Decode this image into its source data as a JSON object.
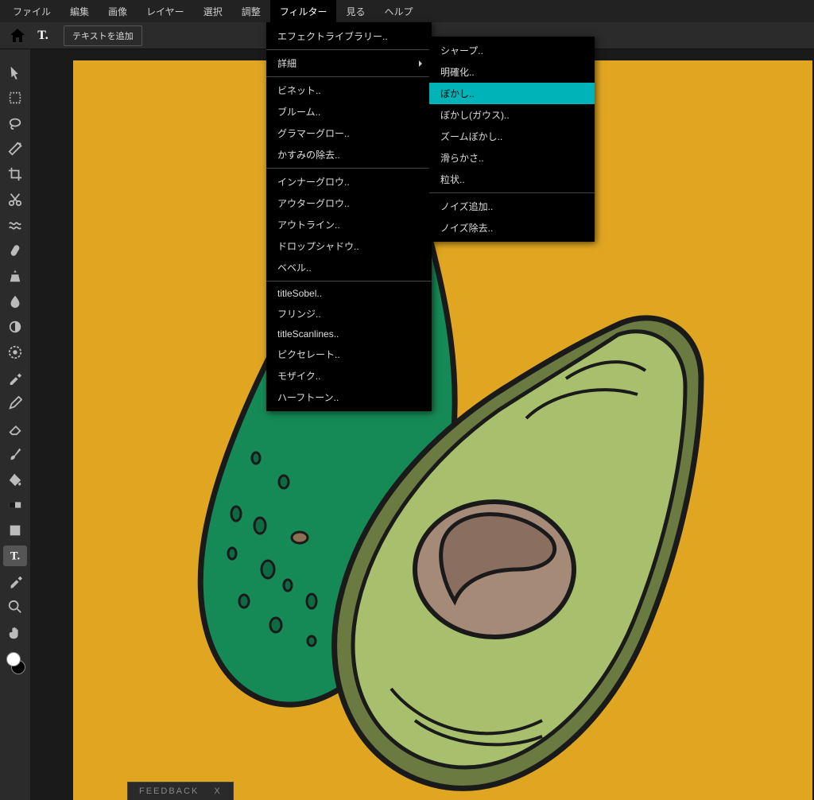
{
  "menubar": {
    "items": [
      {
        "label": "ファイル"
      },
      {
        "label": "編集"
      },
      {
        "label": "画像"
      },
      {
        "label": "レイヤー"
      },
      {
        "label": "選択"
      },
      {
        "label": "調整"
      },
      {
        "label": "フィルター",
        "active": true
      },
      {
        "label": "見る"
      },
      {
        "label": "ヘルプ"
      }
    ]
  },
  "toolbar": {
    "text_button": "テキストを追加"
  },
  "filter_menu": {
    "items": [
      {
        "label": "エフェクトライブラリー..",
        "sep_after": true
      },
      {
        "label": "詳細",
        "has_sub": true,
        "sep_after": true
      },
      {
        "label": "ビネット.."
      },
      {
        "label": "ブルーム.."
      },
      {
        "label": "グラマーグロー.."
      },
      {
        "label": "かすみの除去..",
        "sep_after": true
      },
      {
        "label": "インナーグロウ.."
      },
      {
        "label": "アウターグロウ.."
      },
      {
        "label": "アウトライン.."
      },
      {
        "label": "ドロップシャドウ.."
      },
      {
        "label": "ベベル..",
        "sep_after": true
      },
      {
        "label": "titleSobel.."
      },
      {
        "label": "フリンジ.."
      },
      {
        "label": "titleScanlines.."
      },
      {
        "label": "ピクセレート.."
      },
      {
        "label": "モザイク.."
      },
      {
        "label": "ハーフトーン.."
      }
    ]
  },
  "filter_submenu": {
    "items": [
      {
        "label": "シャープ.."
      },
      {
        "label": "明確化.."
      },
      {
        "label": "ぼかし..",
        "highlight": true
      },
      {
        "label": "ぼかし(ガウス).."
      },
      {
        "label": "ズームぼかし.."
      },
      {
        "label": "滑らかさ.."
      },
      {
        "label": "粒状..",
        "sep_after": true
      },
      {
        "label": "ノイズ追加.."
      },
      {
        "label": "ノイズ除去.."
      }
    ]
  },
  "tools": [
    {
      "name": "arrow-tool"
    },
    {
      "name": "marquee-tool"
    },
    {
      "name": "lasso-tool"
    },
    {
      "name": "wand-tool"
    },
    {
      "name": "crop-tool"
    },
    {
      "name": "cut-tool"
    },
    {
      "name": "liquify-tool"
    },
    {
      "name": "heal-tool"
    },
    {
      "name": "clone-tool"
    },
    {
      "name": "blur-tool"
    },
    {
      "name": "dodge-tool"
    },
    {
      "name": "sponge-tool"
    },
    {
      "name": "colorpick-tool"
    },
    {
      "name": "pen-tool"
    },
    {
      "name": "eraser-tool"
    },
    {
      "name": "brush-tool"
    },
    {
      "name": "fill-tool"
    },
    {
      "name": "gradient-tool"
    },
    {
      "name": "shape-tool"
    },
    {
      "name": "text-tool",
      "active": true
    },
    {
      "name": "eyedropper-tool"
    },
    {
      "name": "zoom-tool"
    },
    {
      "name": "hand-tool"
    }
  ],
  "feedback": {
    "label": "FEEDBACK",
    "close": "X"
  }
}
